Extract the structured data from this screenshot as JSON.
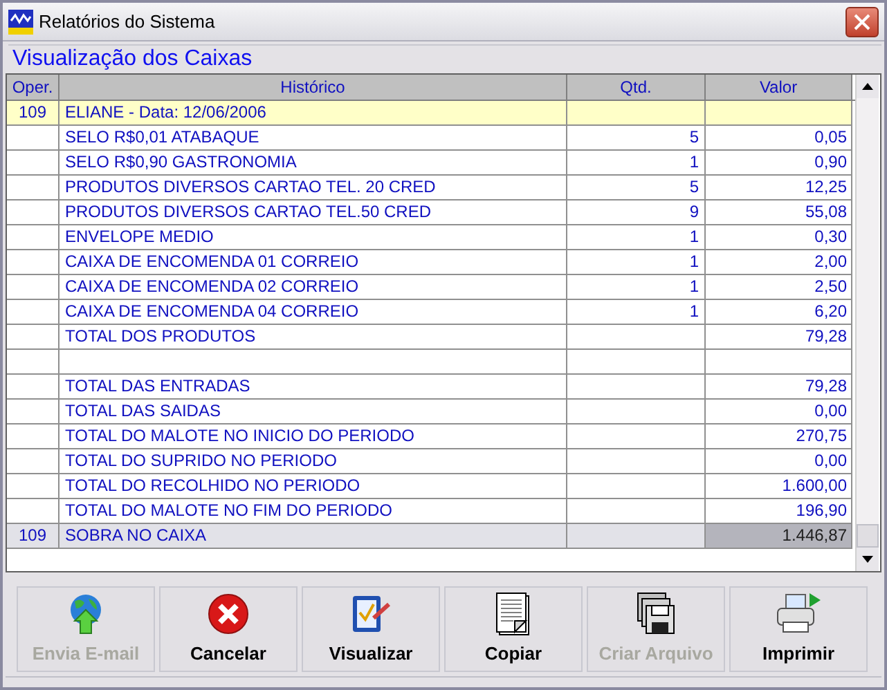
{
  "window": {
    "title": "Relatórios do Sistema"
  },
  "group": {
    "title": "Visualização dos Caixas"
  },
  "table": {
    "columns": [
      "Oper.",
      "Histórico",
      "Qtd.",
      "Valor"
    ],
    "rows": [
      {
        "kind": "header",
        "oper": "109",
        "historico": "ELIANE  - Data: 12/06/2006"
      },
      {
        "kind": "item",
        "historico": "SELO R$0,01 ATABAQUE",
        "qtd": "5",
        "valor": "0,05"
      },
      {
        "kind": "item",
        "historico": "SELO R$0,90 GASTRONOMIA",
        "qtd": "1",
        "valor": "0,90"
      },
      {
        "kind": "item",
        "historico": "PRODUTOS DIVERSOS CARTAO TEL. 20 CRED",
        "qtd": "5",
        "valor": "12,25"
      },
      {
        "kind": "item",
        "historico": "PRODUTOS DIVERSOS CARTAO TEL.50 CRED",
        "qtd": "9",
        "valor": "55,08"
      },
      {
        "kind": "item",
        "historico": "ENVELOPE MEDIO",
        "qtd": "1",
        "valor": "0,30"
      },
      {
        "kind": "item",
        "historico": "CAIXA DE ENCOMENDA 01 CORREIO",
        "qtd": "1",
        "valor": "2,00"
      },
      {
        "kind": "item",
        "historico": "CAIXA DE ENCOMENDA 02 CORREIO",
        "qtd": "1",
        "valor": "2,50"
      },
      {
        "kind": "item",
        "historico": "CAIXA DE ENCOMENDA 04 CORREIO",
        "qtd": "1",
        "valor": "6,20"
      },
      {
        "kind": "item",
        "historico": "TOTAL DOS PRODUTOS",
        "valor": "79,28"
      },
      {
        "kind": "blank"
      },
      {
        "kind": "item",
        "historico": "TOTAL DAS ENTRADAS",
        "valor": "79,28"
      },
      {
        "kind": "item",
        "historico": "TOTAL DAS SAIDAS",
        "valor": "0,00"
      },
      {
        "kind": "item",
        "historico": "TOTAL DO MALOTE NO INICIO DO PERIODO",
        "valor": "270,75"
      },
      {
        "kind": "item",
        "historico": "TOTAL DO SUPRIDO NO PERIODO",
        "valor": "0,00"
      },
      {
        "kind": "item",
        "historico": "TOTAL DO RECOLHIDO NO PERIODO",
        "valor": "1.600,00"
      },
      {
        "kind": "item",
        "historico": "TOTAL DO MALOTE NO FIM DO PERIODO",
        "valor": "196,90"
      },
      {
        "kind": "total",
        "oper": "109",
        "historico": "SOBRA NO CAIXA",
        "valor": "1.446,87"
      }
    ]
  },
  "buttons": [
    {
      "label": "Envia E-mail",
      "disabled": true
    },
    {
      "label": "Cancelar",
      "disabled": false
    },
    {
      "label": "Visualizar",
      "disabled": false
    },
    {
      "label": "Copiar",
      "disabled": false
    },
    {
      "label": "Criar Arquivo",
      "disabled": true
    },
    {
      "label": "Imprimir",
      "disabled": false
    }
  ]
}
